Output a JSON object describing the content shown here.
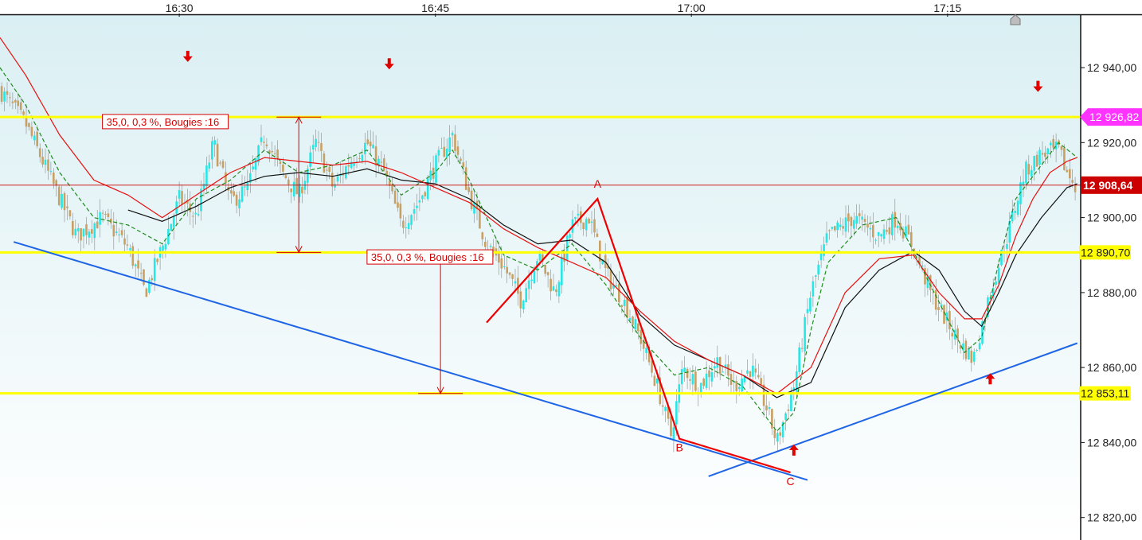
{
  "chart_data": {
    "type": "candlestick",
    "x_axis": {
      "ticks": [
        {
          "label": "16:30",
          "minute": 30
        },
        {
          "label": "16:45",
          "minute": 45
        },
        {
          "label": "17:00",
          "minute": 60
        },
        {
          "label": "17:15",
          "minute": 75
        }
      ],
      "range_minutes": [
        19.5,
        82.8
      ]
    },
    "y_axis": {
      "ticks": [
        {
          "label": "12 940,00",
          "value": 12940
        },
        {
          "label": "12 920,00",
          "value": 12920
        },
        {
          "label": "12 900,00",
          "value": 12900
        },
        {
          "label": "12 880,00",
          "value": 12880
        },
        {
          "label": "12 860,00",
          "value": 12860
        },
        {
          "label": "12 840,00",
          "value": 12840
        },
        {
          "label": "12 820,00",
          "value": 12820
        }
      ],
      "range": [
        12814,
        12954
      ]
    },
    "price_path": [
      [
        19.5,
        12934
      ],
      [
        21.0,
        12925
      ],
      [
        22.5,
        12910
      ],
      [
        24.0,
        12895
      ],
      [
        25.5,
        12900
      ],
      [
        27.0,
        12892
      ],
      [
        28.0,
        12880
      ],
      [
        29.0,
        12892
      ],
      [
        30.0,
        12905
      ],
      [
        31.0,
        12900
      ],
      [
        32.0,
        12920
      ],
      [
        33.0,
        12904
      ],
      [
        34.0,
        12908
      ],
      [
        35.0,
        12922
      ],
      [
        36.0,
        12912
      ],
      [
        37.0,
        12906
      ],
      [
        38.0,
        12920
      ],
      [
        39.0,
        12908
      ],
      [
        40.0,
        12915
      ],
      [
        41.0,
        12920
      ],
      [
        42.0,
        12912
      ],
      [
        43.0,
        12898
      ],
      [
        44.0,
        12904
      ],
      [
        45.0,
        12914
      ],
      [
        46.0,
        12922
      ],
      [
        47.0,
        12906
      ],
      [
        48.0,
        12893
      ],
      [
        49.0,
        12887
      ],
      [
        50.0,
        12878
      ],
      [
        51.0,
        12890
      ],
      [
        52.0,
        12880
      ],
      [
        53.0,
        12898
      ],
      [
        54.0,
        12900
      ],
      [
        55.0,
        12885
      ],
      [
        56.0,
        12878
      ],
      [
        57.0,
        12868
      ],
      [
        58.0,
        12855
      ],
      [
        58.8,
        12842
      ],
      [
        59.5,
        12860
      ],
      [
        60.5,
        12855
      ],
      [
        61.5,
        12862
      ],
      [
        62.5,
        12855
      ],
      [
        63.5,
        12860
      ],
      [
        64.5,
        12848
      ],
      [
        65.0,
        12840
      ],
      [
        66.0,
        12855
      ],
      [
        67.0,
        12880
      ],
      [
        68.0,
        12895
      ],
      [
        69.5,
        12900
      ],
      [
        71.0,
        12895
      ],
      [
        72.0,
        12900
      ],
      [
        73.0,
        12892
      ],
      [
        74.0,
        12880
      ],
      [
        75.5,
        12868
      ],
      [
        76.5,
        12862
      ],
      [
        77.5,
        12880
      ],
      [
        78.5,
        12895
      ],
      [
        79.5,
        12912
      ],
      [
        80.5,
        12917
      ],
      [
        81.5,
        12918
      ],
      [
        82.0,
        12912
      ],
      [
        82.6,
        12908
      ]
    ],
    "ma_red_path": [
      [
        19.5,
        12948
      ],
      [
        21.0,
        12938
      ],
      [
        23.0,
        12922
      ],
      [
        25.0,
        12910
      ],
      [
        27.0,
        12906
      ],
      [
        29.0,
        12900
      ],
      [
        31.0,
        12906
      ],
      [
        33.0,
        12912
      ],
      [
        35.0,
        12916
      ],
      [
        37.0,
        12915
      ],
      [
        39.0,
        12914
      ],
      [
        41.0,
        12915
      ],
      [
        43.0,
        12912
      ],
      [
        45.0,
        12908
      ],
      [
        47.0,
        12904
      ],
      [
        49.0,
        12897
      ],
      [
        51.0,
        12892
      ],
      [
        53.0,
        12888
      ],
      [
        55.0,
        12884
      ],
      [
        57.0,
        12875
      ],
      [
        59.0,
        12867
      ],
      [
        61.0,
        12862
      ],
      [
        63.0,
        12858
      ],
      [
        65.0,
        12853
      ],
      [
        67.0,
        12860
      ],
      [
        69.0,
        12880
      ],
      [
        71.0,
        12889
      ],
      [
        73.0,
        12890
      ],
      [
        74.5,
        12880
      ],
      [
        76.0,
        12873
      ],
      [
        77.0,
        12873
      ],
      [
        78.0,
        12882
      ],
      [
        79.0,
        12895
      ],
      [
        80.0,
        12905
      ],
      [
        81.0,
        12912
      ],
      [
        82.0,
        12915
      ],
      [
        82.6,
        12916
      ]
    ],
    "ma_green_path": [
      [
        19.5,
        12940
      ],
      [
        21.0,
        12930
      ],
      [
        23.0,
        12912
      ],
      [
        25.0,
        12900
      ],
      [
        27.0,
        12898
      ],
      [
        29.0,
        12893
      ],
      [
        31.0,
        12905
      ],
      [
        33.0,
        12910
      ],
      [
        35.0,
        12918
      ],
      [
        37.0,
        12912
      ],
      [
        39.0,
        12914
      ],
      [
        41.0,
        12918
      ],
      [
        43.0,
        12906
      ],
      [
        45.0,
        12912
      ],
      [
        46.0,
        12918
      ],
      [
        47.0,
        12910
      ],
      [
        49.0,
        12890
      ],
      [
        51.0,
        12886
      ],
      [
        53.0,
        12893
      ],
      [
        55.0,
        12882
      ],
      [
        57.0,
        12868
      ],
      [
        59.0,
        12858
      ],
      [
        61.0,
        12860
      ],
      [
        63.0,
        12855
      ],
      [
        65.0,
        12843
      ],
      [
        66.0,
        12848
      ],
      [
        67.0,
        12870
      ],
      [
        68.0,
        12888
      ],
      [
        70.0,
        12898
      ],
      [
        72.0,
        12900
      ],
      [
        74.0,
        12882
      ],
      [
        76.0,
        12864
      ],
      [
        77.0,
        12868
      ],
      [
        78.0,
        12888
      ],
      [
        79.0,
        12905
      ],
      [
        80.5,
        12914
      ],
      [
        81.5,
        12920
      ],
      [
        82.6,
        12916
      ]
    ],
    "ma_black_path": [
      [
        27.0,
        12902
      ],
      [
        29.0,
        12899
      ],
      [
        31.0,
        12903
      ],
      [
        33.0,
        12908
      ],
      [
        35.0,
        12911
      ],
      [
        37.0,
        12912
      ],
      [
        39.0,
        12911
      ],
      [
        41.0,
        12913
      ],
      [
        43.0,
        12910
      ],
      [
        45.0,
        12909
      ],
      [
        47.0,
        12905
      ],
      [
        49.0,
        12898
      ],
      [
        51.0,
        12893
      ],
      [
        53.0,
        12894
      ],
      [
        55.0,
        12888
      ],
      [
        57.0,
        12874
      ],
      [
        59.0,
        12866
      ],
      [
        61.0,
        12862
      ],
      [
        63.0,
        12858
      ],
      [
        65.0,
        12852
      ],
      [
        67.0,
        12856
      ],
      [
        69.0,
        12876
      ],
      [
        71.0,
        12886
      ],
      [
        73.0,
        12891
      ],
      [
        74.5,
        12886
      ],
      [
        76.0,
        12875
      ],
      [
        77.0,
        12871
      ],
      [
        78.0,
        12880
      ],
      [
        79.0,
        12890
      ],
      [
        80.5,
        12900
      ],
      [
        82.0,
        12908
      ],
      [
        82.6,
        12909
      ]
    ],
    "support_resistance_levels": [
      {
        "label": "12 926,82",
        "value": 12926.82,
        "badge_color": "#ff33ff",
        "text_color": "#ffffff"
      },
      {
        "label": "12 890,70",
        "value": 12890.7,
        "badge_color": "#ffff00",
        "text_color": "#222222"
      },
      {
        "label": "12 853,11",
        "value": 12853.11,
        "badge_color": "#ffff00",
        "text_color": "#222222"
      }
    ],
    "current_price": {
      "label": "12 908,64",
      "value": 12908.64,
      "badge_color": "#cc0000"
    },
    "annotations": [
      {
        "text": "35,0, 0,3 %, Bougies :16",
        "minute": 25.5,
        "value": 12925.6,
        "from": 12926.8,
        "to": 12890.7,
        "arrow_minute": 37.0
      },
      {
        "text": "35,0, 0,3 %, Bougies :16",
        "minute": 41.0,
        "value": 12889.5,
        "from": 12890.7,
        "to": 12853.1,
        "arrow_minute": 45.3
      }
    ],
    "trendlines": [
      {
        "color": "#1e64e6",
        "from": [
          20.3,
          12893.5
        ],
        "to": [
          66.8,
          12830
        ]
      },
      {
        "color": "#1e64e6",
        "from": [
          61.0,
          12831
        ],
        "to": [
          82.6,
          12866.5
        ]
      }
    ],
    "abc_pattern": {
      "points": [
        {
          "label": "",
          "minute": 48.0,
          "value": 12872
        },
        {
          "label": "A",
          "minute": 54.5,
          "value": 12905
        },
        {
          "label": "B",
          "minute": 59.3,
          "value": 12841
        },
        {
          "label": "C",
          "minute": 65.8,
          "value": 12832
        }
      ],
      "color": "#ee0000"
    },
    "signals": [
      {
        "direction": "down",
        "minute": 30.5,
        "value": 12943
      },
      {
        "direction": "down",
        "minute": 42.3,
        "value": 12941
      },
      {
        "direction": "down",
        "minute": 80.3,
        "value": 12935
      },
      {
        "direction": "up",
        "minute": 66.0,
        "value": 12838
      },
      {
        "direction": "up",
        "minute": 77.5,
        "value": 12857
      }
    ],
    "colors": {
      "bull": "#27e6e6",
      "bear": "#c8a064",
      "ma_red": "#e81010",
      "ma_green": "#1e8c1e",
      "ma_black": "#111111",
      "level_line": "#ffff00",
      "current_line": "#cc0000"
    }
  }
}
